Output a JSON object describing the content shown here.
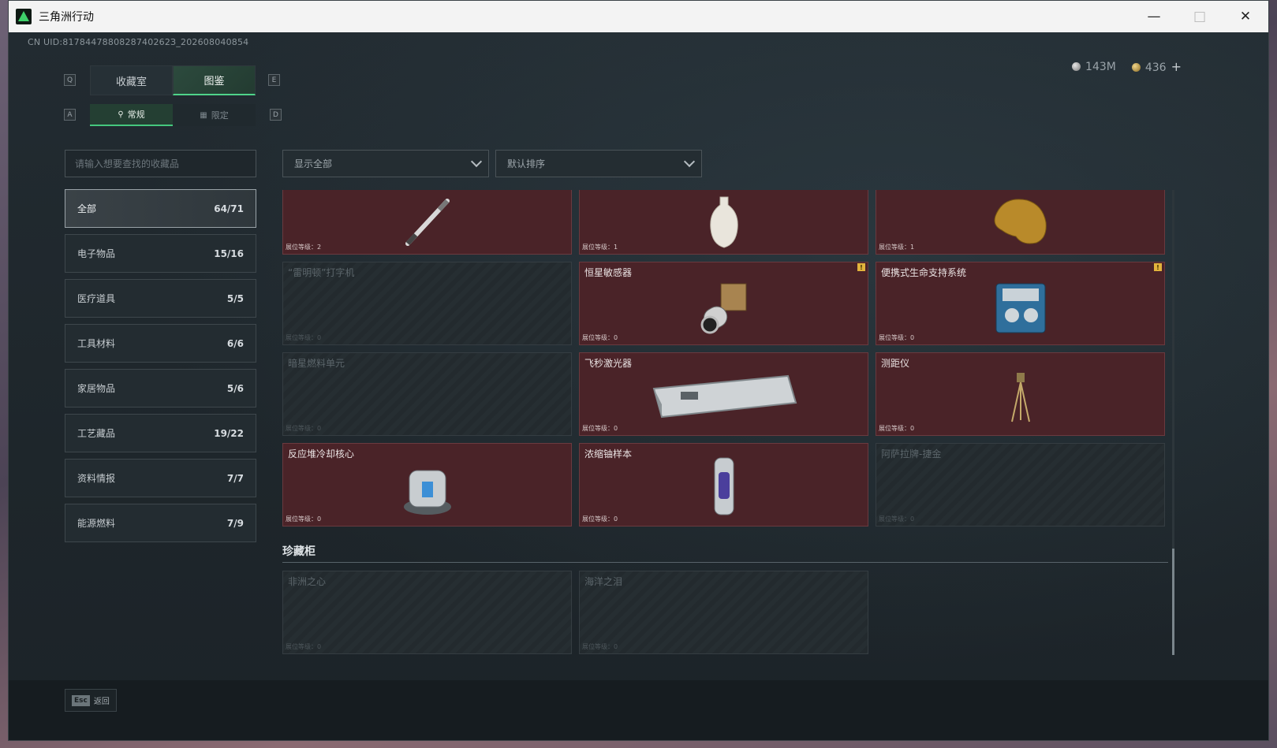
{
  "window": {
    "title": "三角洲行动"
  },
  "uid": "CN UID:8178447880828740262З_202608040854",
  "currency": {
    "silver": "143M",
    "gold": "436",
    "plus": "+"
  },
  "keys": {
    "q": "Q",
    "e": "E",
    "a": "A",
    "d": "D"
  },
  "tabs_main": [
    "收藏室",
    "图鉴"
  ],
  "tabs_sub": [
    "常规",
    "限定"
  ],
  "search": {
    "placeholder": "请输入想要查找的收藏品"
  },
  "categories": [
    {
      "label": "全部",
      "count": "64/71"
    },
    {
      "label": "电子物品",
      "count": "15/16"
    },
    {
      "label": "医疗道具",
      "count": "5/5"
    },
    {
      "label": "工具材料",
      "count": "6/6"
    },
    {
      "label": "家居物品",
      "count": "5/6"
    },
    {
      "label": "工艺藏品",
      "count": "19/22"
    },
    {
      "label": "资料情报",
      "count": "7/7"
    },
    {
      "label": "能源燃料",
      "count": "7/9"
    }
  ],
  "filters": {
    "show": "显示全部",
    "sort": "默认排序"
  },
  "level_label": "展位等级",
  "cards": [
    {
      "name": "",
      "level": "2",
      "locked": false,
      "icon": "pen-icon"
    },
    {
      "name": "",
      "level": "1",
      "locked": false,
      "icon": "vase-icon"
    },
    {
      "name": "",
      "level": "1",
      "locked": false,
      "icon": "golden-horse-head-icon"
    },
    {
      "name": "“雷明顿”打字机",
      "level": "0",
      "locked": true,
      "icon": "typewriter-icon"
    },
    {
      "name": "恒星敏感器",
      "level": "0",
      "locked": false,
      "icon": "star-sensor-icon",
      "new": "!"
    },
    {
      "name": "便携式生命支持系统",
      "level": "0",
      "locked": false,
      "icon": "life-support-icon",
      "new": "!"
    },
    {
      "name": "暗星燃料单元",
      "level": "0",
      "locked": true,
      "icon": "fuel-cell-icon"
    },
    {
      "name": "飞秒激光器",
      "level": "0",
      "locked": false,
      "icon": "laser-device-icon"
    },
    {
      "name": "测距仪",
      "level": "0",
      "locked": false,
      "icon": "tripod-rangefinder-icon"
    },
    {
      "name": "反应堆冷却核心",
      "level": "0",
      "locked": false,
      "icon": "reactor-core-icon"
    },
    {
      "name": "浓缩铀样本",
      "level": "0",
      "locked": false,
      "icon": "uranium-capsule-icon"
    },
    {
      "name": "阿萨拉牌-捷金",
      "level": "0",
      "locked": true,
      "icon": "card-icon"
    }
  ],
  "section2": {
    "title": "珍藏柜",
    "cards": [
      {
        "name": "非洲之心",
        "level": "0",
        "locked": true,
        "icon": "diamond-icon"
      },
      {
        "name": "海洋之泪",
        "level": "0",
        "locked": true,
        "icon": "gem-icon"
      }
    ]
  },
  "footer": {
    "esc": "Esc",
    "back": "返回"
  },
  "colors": {
    "accent": "#4fd38a",
    "owned_card": "#4a2328",
    "tag": "#e2b33c"
  }
}
